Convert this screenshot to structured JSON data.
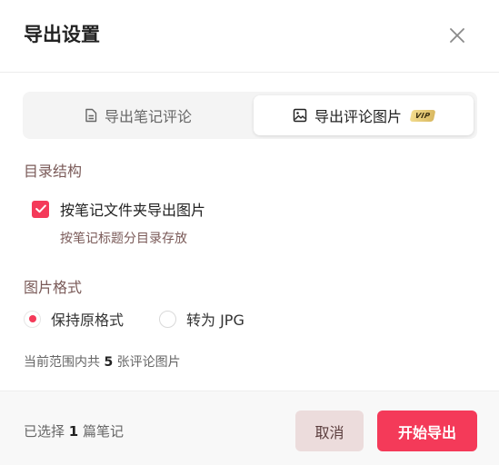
{
  "dialog": {
    "title": "导出设置"
  },
  "tabs": {
    "notes_label": "导出笔记评论",
    "images_label": "导出评论图片",
    "vip_badge": "VIP"
  },
  "directory": {
    "section_label": "目录结构",
    "checkbox_label": "按笔记文件夹导出图片",
    "checkbox_checked": true,
    "hint": "按笔记标题分目录存放"
  },
  "format": {
    "section_label": "图片格式",
    "options": [
      {
        "label": "保持原格式",
        "selected": true
      },
      {
        "label": "转为 JPG",
        "selected": false
      }
    ]
  },
  "summary": {
    "prefix": "当前范围内共",
    "count": "5",
    "suffix": "张评论图片"
  },
  "footer": {
    "selected_prefix": "已选择",
    "selected_count": "1",
    "selected_suffix": "篇笔记",
    "cancel_label": "取消",
    "start_label": "开始导出"
  },
  "colors": {
    "accent": "#f43a59",
    "section_label": "#7a5a58",
    "cancel_bg": "#ecdcdc"
  }
}
